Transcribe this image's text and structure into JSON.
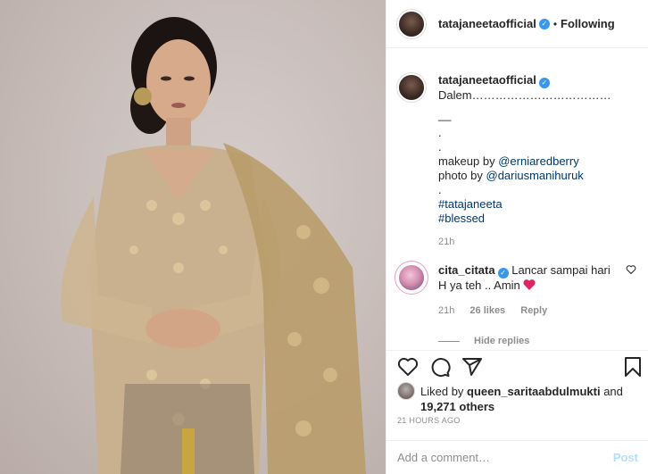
{
  "post": {
    "author": "tatajaneetaofficial",
    "follow_status": "Following",
    "dot": "•",
    "image_alt": "Woman in gold lace kebaya with shawl",
    "caption": {
      "first_line": "Dalem………………………………",
      "line2": "__",
      "line3": ".",
      "line4": ".",
      "makeup_prefix": "makeup by ",
      "makeup_link": "@erniaredberry",
      "photo_prefix": "photo by ",
      "photo_link": "@dariusmanihuruk",
      "line7": ".",
      "tag1": "#tatajaneeta",
      "tag2": "#blessed",
      "time": "21h"
    },
    "reply": {
      "author": "cita_citata",
      "text_line1": "Lancar sampai hari",
      "text_line2": "H ya teh .. Amin",
      "time": "21h",
      "likes": "26 likes",
      "reply_label": "Reply",
      "hide_replies": "Hide replies"
    },
    "liked_by_prefix": "Liked by ",
    "liked_by_user": "queen_saritaabdulmukti",
    "liked_by_and": " and",
    "liked_count": "19,271 others",
    "timestamp": "21 HOURS AGO",
    "comment_placeholder": "Add a comment…",
    "post_button": "Post",
    "icons": [
      "heart-icon",
      "comment-icon",
      "share-icon",
      "bookmark-icon",
      "verified-badge-icon",
      "red-heart-emoji"
    ],
    "colors": {
      "link": "#00376b",
      "verified": "#3897f0",
      "post_disabled": "#b2dffc",
      "emoji_heart": "#e0245e"
    }
  }
}
